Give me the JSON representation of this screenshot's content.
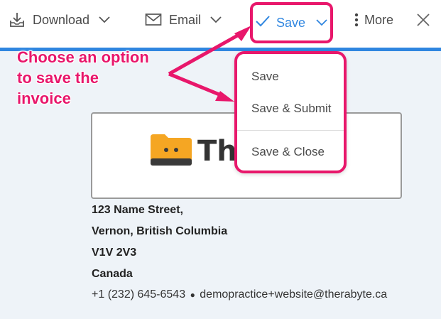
{
  "toolbar": {
    "download_label": "Download",
    "email_label": "Email",
    "save_label": "Save",
    "more_label": "More"
  },
  "annotation": {
    "line1": "Choose an option",
    "line2": "to save the",
    "line3": "invoice"
  },
  "save_menu": {
    "items": [
      "Save",
      "Save & Submit",
      "Save & Close"
    ]
  },
  "logo": {
    "text": "Th",
    "icon": "folder-logo-icon"
  },
  "address": {
    "street": "123 Name Street,",
    "city": "Vernon, British Columbia",
    "postal": "V1V 2V3",
    "country": "Canada"
  },
  "contact": {
    "phone": "+1 (232) 645-6543",
    "separator": "●",
    "email": "demopractice+website@therabyte.ca"
  },
  "colors": {
    "accent": "#2f86e0",
    "highlight": "#e8176b",
    "logo_orange": "#f5a623"
  }
}
